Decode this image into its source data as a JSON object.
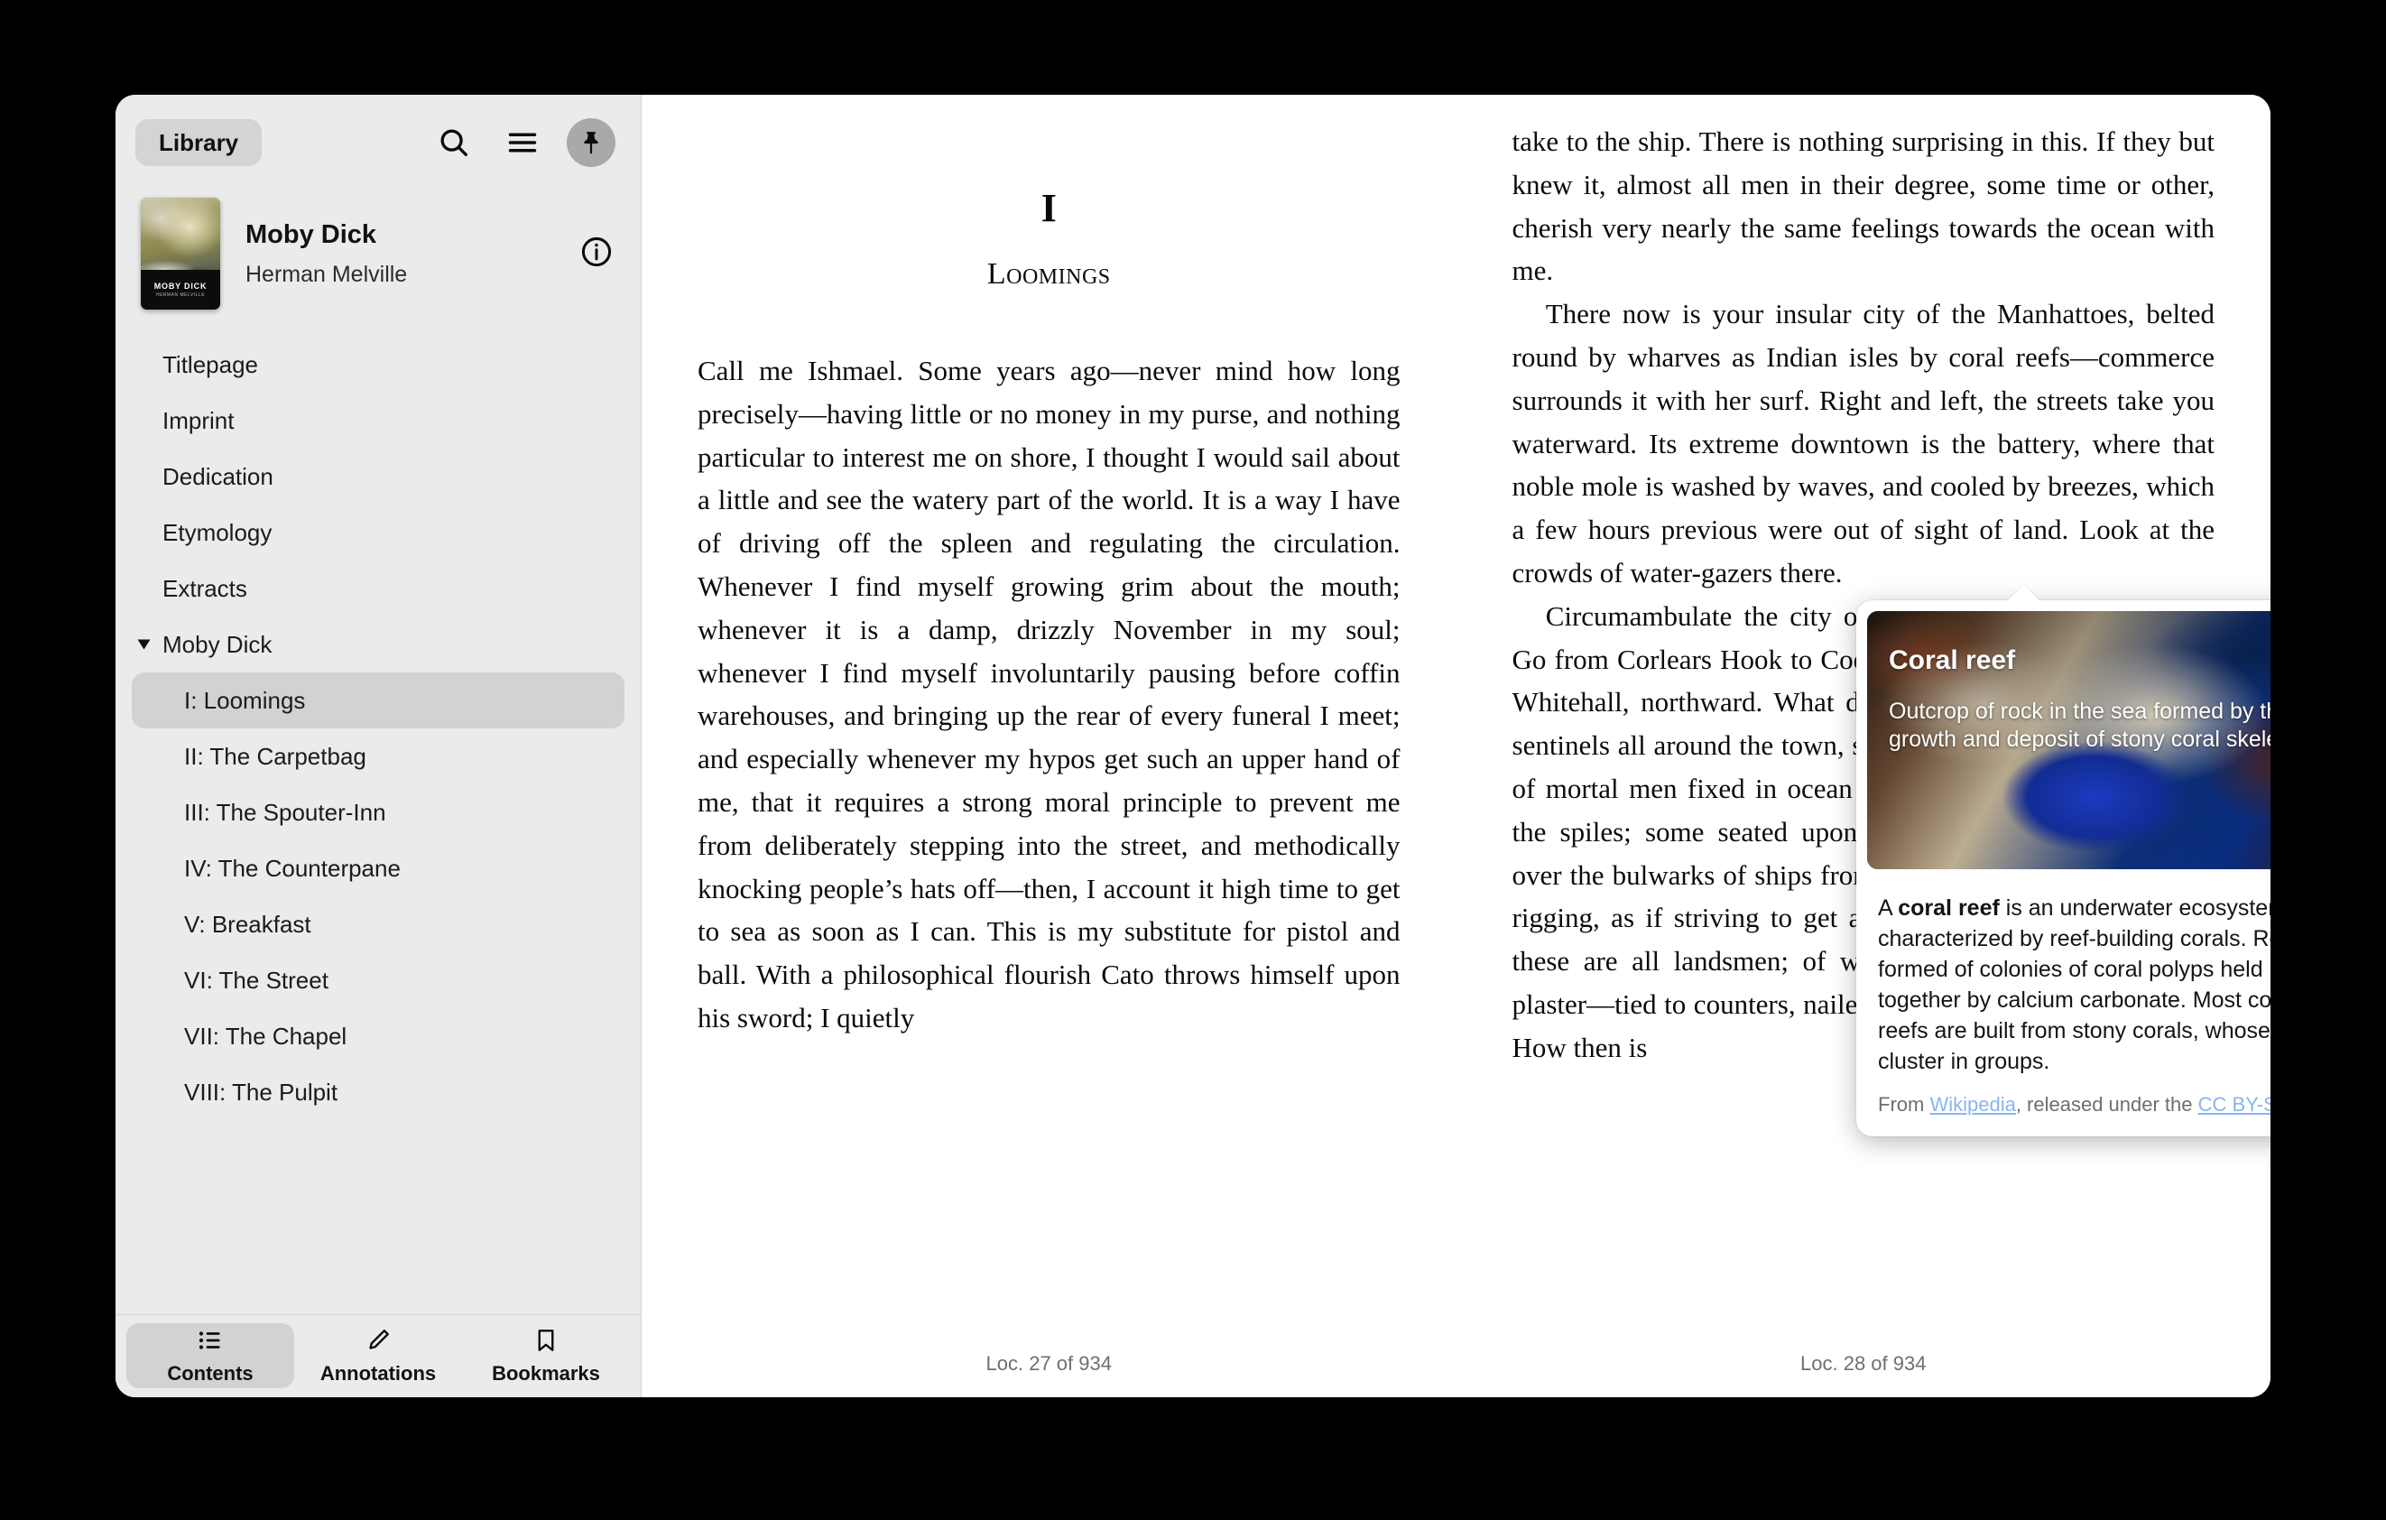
{
  "sidebar": {
    "library_button": "Library",
    "icons": {
      "search": "search-icon",
      "menu": "hamburger-menu-icon",
      "pin": "pin-icon",
      "info": "info-circle-icon"
    },
    "book": {
      "title": "Moby Dick",
      "author": "Herman Melville",
      "cover_title": "MOBY DICK",
      "cover_author": "HERMAN MELVILLE"
    },
    "toc": [
      {
        "label": "Titlepage",
        "level": 1,
        "selected": false,
        "expandable": false
      },
      {
        "label": "Imprint",
        "level": 1,
        "selected": false,
        "expandable": false
      },
      {
        "label": "Dedication",
        "level": 1,
        "selected": false,
        "expandable": false
      },
      {
        "label": "Etymology",
        "level": 1,
        "selected": false,
        "expandable": false
      },
      {
        "label": "Extracts",
        "level": 1,
        "selected": false,
        "expandable": false
      },
      {
        "label": "Moby Dick",
        "level": 1,
        "selected": false,
        "expandable": true
      },
      {
        "label": "I: Loomings",
        "level": 2,
        "selected": true,
        "expandable": false
      },
      {
        "label": "II: The Carpetbag",
        "level": 2,
        "selected": false,
        "expandable": false
      },
      {
        "label": "III: The Spouter-Inn",
        "level": 2,
        "selected": false,
        "expandable": false
      },
      {
        "label": "IV: The Counterpane",
        "level": 2,
        "selected": false,
        "expandable": false
      },
      {
        "label": "V: Breakfast",
        "level": 2,
        "selected": false,
        "expandable": false
      },
      {
        "label": "VI: The Street",
        "level": 2,
        "selected": false,
        "expandable": false
      },
      {
        "label": "VII: The Chapel",
        "level": 2,
        "selected": false,
        "expandable": false
      },
      {
        "label": "VIII: The Pulpit",
        "level": 2,
        "selected": false,
        "expandable": false
      }
    ],
    "tabs": [
      {
        "label": "Contents",
        "icon": "list-bullets-icon",
        "active": true
      },
      {
        "label": "Annotations",
        "icon": "pencil-icon",
        "active": false
      },
      {
        "label": "Bookmarks",
        "icon": "bookmark-icon",
        "active": false
      }
    ]
  },
  "reader": {
    "chapter_number": "I",
    "chapter_title": "Loomings",
    "left_page": {
      "paragraph": "Call me Ishmael. Some years ago—never mind how long precisely—having little or no money in my purse, and nothing particular to interest me on shore, I thought I would sail about a little and see the watery part of the world. It is a way I have of driving off the spleen and regulating the circulation. Whenever I find myself growing grim about the mouth; whenever it is a damp, drizzly November in my soul; whenever I find myself involuntarily pausing before coffin warehouses, and bringing up the rear of every funeral I meet; and especially whenever my hypos get such an upper hand of me, that it requires a strong moral principle to prevent me from deliberately stepping into the street, and methodically knocking people’s hats off—then, I account it high time to get to sea as soon as I can. This is my substitute for pistol and ball. With a philosophical flourish Cato throws himself upon his sword; I quietly",
      "location": "Loc. 27 of 934"
    },
    "right_page": {
      "paragraph_1": "take to the ship. There is nothing surprising in this. If they but knew it, almost all men in their degree, some time or other, cherish very nearly the same feelings towards the ocean with me.",
      "paragraph_2": "There now is your insular city of the Manhattoes, belted round by wharves as Indian isles by coral reefs—commerce surrounds it with her surf. Right and left, the streets take you waterward. Its extreme downtown is the battery, where that noble mole is washed by waves, and cooled by breezes, which a few hours previous were out of sight of land. Look at the crowds of water-gazers there.",
      "paragraph_3": "Circumambulate the city of a dreamy Sabbath afternoon. Go from Corlears Hook to Coenties Slip, and from thence, by Whitehall, northward. What do you see?—Posted like silent sentinels all around the town, stand thousands upon thousands of mortal men fixed in ocean reveries. Some leaning against the spiles; some seated upon the pier-heads; some looking over the bulwarks of ships from China; some high aloft in the rigging, as if striving to get a still better seaward peep. But these are all landsmen; of week days pent up in lath and plaster—tied to counters, nailed to benches, clinched to desks. How then is",
      "location": "Loc. 28 of 934"
    }
  },
  "popup": {
    "title": "Coral reef",
    "subtitle": "Outcrop of rock in the sea formed by the growth and deposit of stony coral skeletons",
    "body_prefix": "A ",
    "body_bold": "coral reef",
    "body_rest": " is an underwater ecosystem characterized by reef-building corals. Reefs are formed of colonies of coral polyps held together by calcium carbonate. Most coral reefs are built from stony corals, whose polyps cluster in groups.",
    "credit_prefix": "From ",
    "credit_source": "Wikipedia",
    "credit_middle": ", released under the ",
    "credit_license": "CC BY-SA"
  },
  "colors": {
    "sidebar_bg": "#ebebeb",
    "selection_bg": "#d2d2d2",
    "link": "#8ab4f0",
    "muted_text": "#6f6f6f"
  }
}
